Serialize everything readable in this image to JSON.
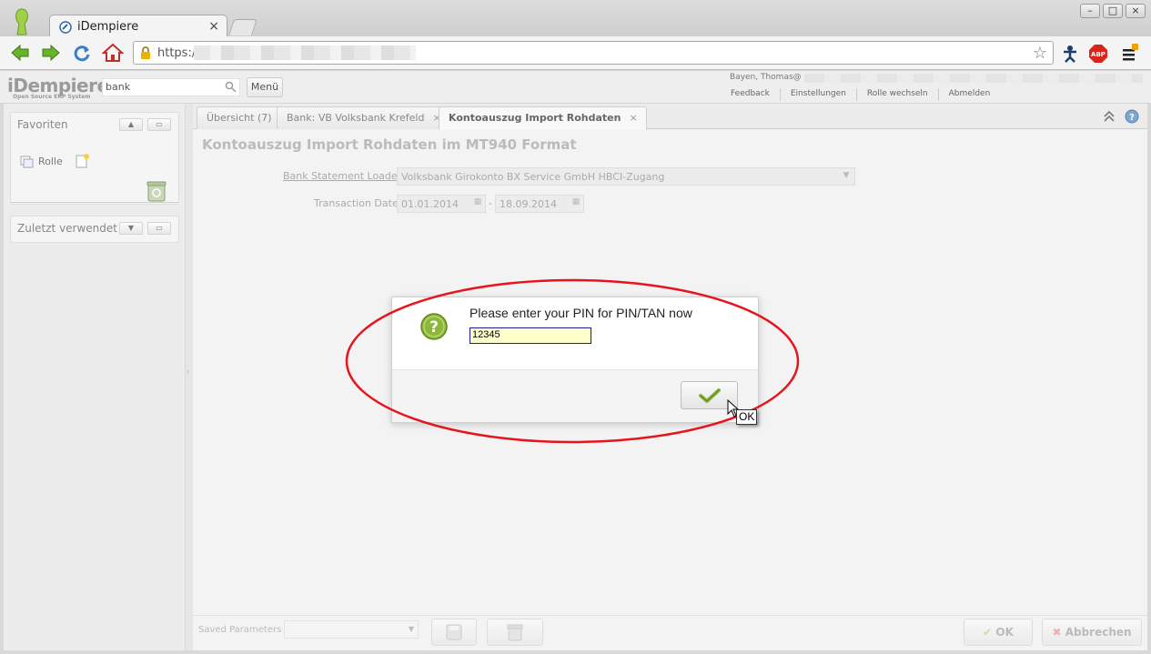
{
  "browser": {
    "tab_title": "iDempiere",
    "tab_close": "×",
    "url_prefix": "https://",
    "window_buttons": [
      "–",
      "□",
      "×"
    ]
  },
  "app": {
    "logo": "iDempiere",
    "logo_sub": "Open Source ERP System",
    "search_value": "bank",
    "menu_label": "Menü",
    "user": "Bayen, Thomas@",
    "links": [
      "Feedback",
      "Einstellungen",
      "Rolle wechseln",
      "Abmelden"
    ]
  },
  "left_panel": {
    "favorites_title": "Favoriten",
    "favorites_role": "Rolle",
    "recent_title": "Zuletzt verwendet"
  },
  "tabs": [
    {
      "label": "Übersicht (7)"
    },
    {
      "label": "Bank: VB Volksbank Krefeld",
      "close": "×"
    },
    {
      "label": "Kontoauszug Import Rohdaten",
      "close": "×"
    }
  ],
  "form": {
    "title": "Kontoauszug Import Rohdaten im MT940 Format",
    "loader_label": "Bank Statement Loader*",
    "loader_value": "Volksbank Girokonto BX Service GmbH HBCI-Zugang",
    "date_label": "Transaction Date",
    "date_from": "01.01.2014",
    "date_sep": "-",
    "date_to": "18.09.2014"
  },
  "bottom": {
    "saved_params_label": "Saved Parameters",
    "ok_label": "OK",
    "cancel_label": "Abbrechen"
  },
  "dialog": {
    "prompt": "Please enter your PIN for PIN/TAN now",
    "pin_value": "12345",
    "ok_tooltip": "OK"
  },
  "colors": {
    "annotation": "#e8141c",
    "ok_check": "#8ab43c",
    "pin_bg": "#ffffcc"
  }
}
